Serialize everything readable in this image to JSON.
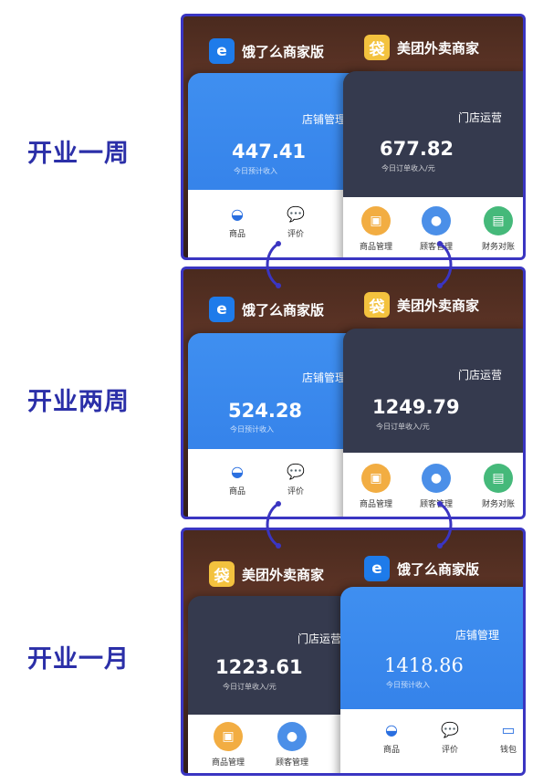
{
  "periods": [
    {
      "label": "开业一周",
      "left_app": {
        "name": "饿了么商家版",
        "section": "店铺管理",
        "amount": "447.41",
        "sub": "今日预计收入",
        "menu": [
          {
            "label": "商品",
            "icon": "bowl-icon"
          },
          {
            "label": "评价",
            "icon": "chat-bubble-icon"
          }
        ]
      },
      "right_app": {
        "name": "美团外卖商家",
        "section": "门店运营",
        "amount": "677.82",
        "sub": "今日订单收入/元",
        "menu": [
          {
            "label": "商品管理",
            "icon": "box-icon"
          },
          {
            "label": "顾客管理",
            "icon": "user-icon"
          },
          {
            "label": "财务对账",
            "icon": "document-icon"
          }
        ]
      }
    },
    {
      "label": "开业两周",
      "left_app": {
        "name": "饿了么商家版",
        "section": "店铺管理",
        "amount": "524.28",
        "sub": "今日预计收入",
        "menu": [
          {
            "label": "商品",
            "icon": "bowl-icon"
          },
          {
            "label": "评价",
            "icon": "chat-bubble-icon"
          }
        ]
      },
      "right_app": {
        "name": "美团外卖商家",
        "section": "门店运营",
        "amount": "1249.79",
        "sub": "今日订单收入/元",
        "menu": [
          {
            "label": "商品管理",
            "icon": "box-icon"
          },
          {
            "label": "顾客管理",
            "icon": "user-icon"
          },
          {
            "label": "财务对账",
            "icon": "document-icon"
          }
        ]
      }
    },
    {
      "label": "开业一月",
      "left_app": {
        "name": "美团外卖商家",
        "section": "门店运营",
        "amount": "1223.61",
        "sub": "今日订单收入/元",
        "menu": [
          {
            "label": "商品管理",
            "icon": "box-icon"
          },
          {
            "label": "顾客管理",
            "icon": "user-icon"
          }
        ]
      },
      "right_app": {
        "name": "饿了么商家版",
        "section": "店铺管理",
        "amount": "1418.86",
        "sub": "今日预计收入",
        "menu": [
          {
            "label": "商品",
            "icon": "bowl-icon"
          },
          {
            "label": "评价",
            "icon": "chat-bubble-icon"
          },
          {
            "label": "钱包",
            "icon": "wallet-icon"
          }
        ]
      }
    }
  ],
  "colors": {
    "label": "#2b2fa8",
    "frame_border": "#3a35c2",
    "eleme_blue": "#2f7be6",
    "meituan_dark": "#353a4e",
    "meituan_yellow": "#f3c23e"
  }
}
